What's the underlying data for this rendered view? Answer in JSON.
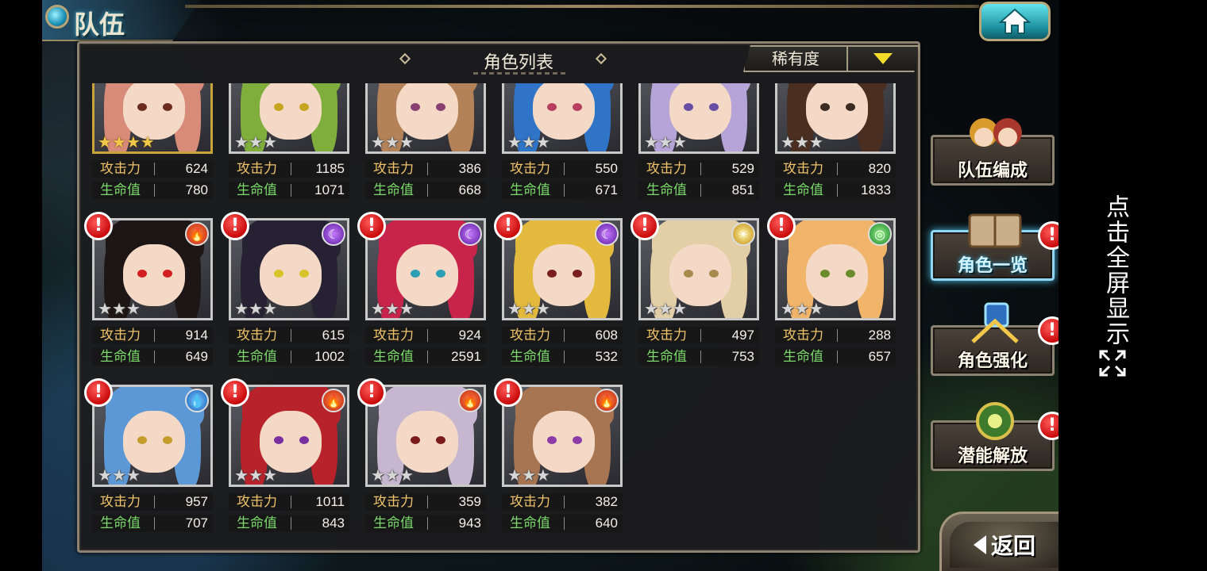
{
  "header": {
    "title": "队伍"
  },
  "panel": {
    "title": "角色列表",
    "sort_label": "稀有度"
  },
  "stat_labels": {
    "attack": "攻击力",
    "hp": "生命值"
  },
  "cards": [
    {
      "atk": "624",
      "hp": "780",
      "stars": "★★★★",
      "rarity": "gold",
      "alert": false,
      "element": null,
      "hair": "#d98b7a",
      "eye": "#6b2b1f"
    },
    {
      "atk": "1185",
      "hp": "1071",
      "stars": "★★★",
      "rarity": "silver",
      "alert": false,
      "element": null,
      "hair": "#7fae3c",
      "eye": "#c6a520"
    },
    {
      "atk": "386",
      "hp": "668",
      "stars": "★★★",
      "rarity": "silver",
      "alert": false,
      "element": null,
      "hair": "#b48258",
      "eye": "#8a3f73"
    },
    {
      "atk": "550",
      "hp": "671",
      "stars": "★★★",
      "rarity": "silver",
      "alert": false,
      "element": null,
      "hair": "#2f74c7",
      "eye": "#b73e60"
    },
    {
      "atk": "529",
      "hp": "851",
      "stars": "★★★",
      "rarity": "silver",
      "alert": false,
      "element": null,
      "hair": "#b6a4d8",
      "eye": "#6a4ea6"
    },
    {
      "atk": "820",
      "hp": "1833",
      "stars": "★★★",
      "rarity": "silver",
      "alert": false,
      "element": null,
      "hair": "#4a2e1f",
      "eye": "#3a2a20"
    },
    {
      "atk": "914",
      "hp": "649",
      "stars": "★★★",
      "rarity": "silver",
      "alert": true,
      "element": "fire",
      "hair": "#1e1616",
      "eye": "#d21e1e"
    },
    {
      "atk": "615",
      "hp": "1002",
      "stars": "★★★",
      "rarity": "silver",
      "alert": true,
      "element": "dark",
      "hair": "#262233",
      "eye": "#d8c32a"
    },
    {
      "atk": "924",
      "hp": "2591",
      "stars": "★★★",
      "rarity": "silver",
      "alert": true,
      "element": "dark",
      "hair": "#c8234a",
      "eye": "#2d9fb5"
    },
    {
      "atk": "608",
      "hp": "532",
      "stars": "★★★",
      "rarity": "silver",
      "alert": true,
      "element": "dark",
      "hair": "#e3b93e",
      "eye": "#7a1e1e"
    },
    {
      "atk": "497",
      "hp": "753",
      "stars": "★★★",
      "rarity": "silver",
      "alert": true,
      "element": "light",
      "hair": "#e2cfa7",
      "eye": "#a88a4d"
    },
    {
      "atk": "288",
      "hp": "657",
      "stars": "★★★",
      "rarity": "silver",
      "alert": true,
      "element": "wind",
      "hair": "#f0b46a",
      "eye": "#6a8c2a"
    },
    {
      "atk": "957",
      "hp": "707",
      "stars": "★★★",
      "rarity": "silver",
      "alert": true,
      "element": "water",
      "hair": "#5d98d6",
      "eye": "#c59b2b"
    },
    {
      "atk": "1011",
      "hp": "843",
      "stars": "★★★",
      "rarity": "silver",
      "alert": true,
      "element": "fire",
      "hair": "#b8222a",
      "eye": "#7a2fa0"
    },
    {
      "atk": "359",
      "hp": "943",
      "stars": "★★★",
      "rarity": "silver",
      "alert": true,
      "element": "fire",
      "hair": "#c7b6d0",
      "eye": "#7a1a1a"
    },
    {
      "atk": "382",
      "hp": "640",
      "stars": "★★★",
      "rarity": "silver",
      "alert": true,
      "element": "fire",
      "hair": "#a87552",
      "eye": "#8b3aa8"
    }
  ],
  "side_menu": [
    {
      "label": "队伍编成",
      "active": false,
      "alert": false
    },
    {
      "label": "角色一览",
      "active": true,
      "alert": true
    },
    {
      "label": "角色强化",
      "active": false,
      "alert": true
    },
    {
      "label": "潜能解放",
      "active": false,
      "alert": true
    }
  ],
  "back": {
    "label": "返回"
  },
  "fullscreen_hint": "点击全屏显示",
  "alert_mark": "!",
  "element_glyphs": {
    "fire": "🔥",
    "dark": "☾",
    "water": "💧",
    "light": "☀",
    "wind": "◎"
  },
  "colors": {
    "accent_cyan": "#4fc4ee",
    "attack_label": "#efc36a",
    "hp_label": "#7bd96b",
    "alert_red": "#c90a0a",
    "sort_arrow": "#f4dc2a"
  }
}
